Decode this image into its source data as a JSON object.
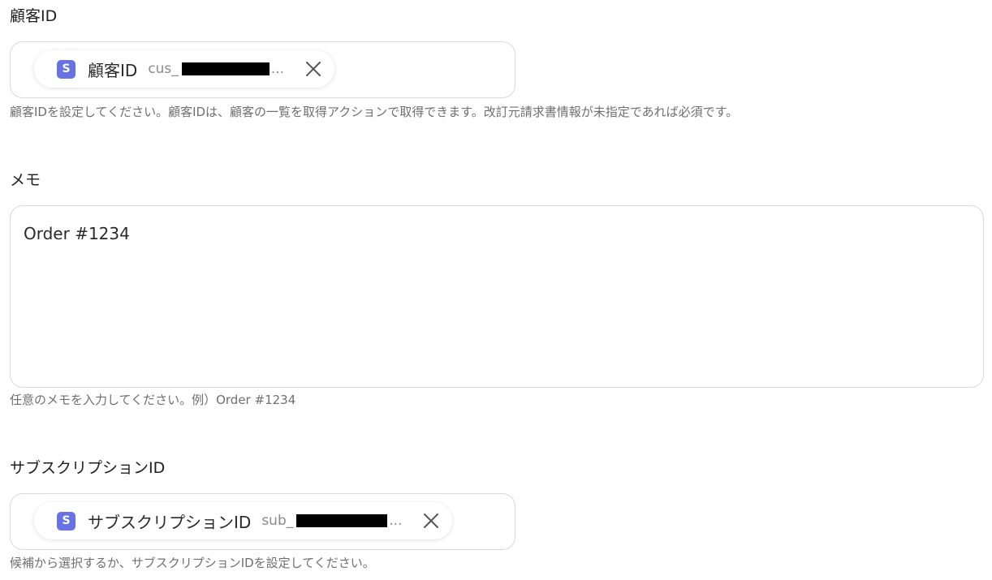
{
  "customer_id": {
    "label": "顧客ID",
    "chip": {
      "icon": "stripe-icon",
      "icon_letter": "S",
      "name": "顧客ID",
      "value_prefix": "cus_",
      "value_suffix": "..."
    },
    "help": "顧客IDを設定してください。顧客IDは、顧客の一覧を取得アクションで取得できます。改訂元請求書情報が未指定であれば必須です。"
  },
  "memo": {
    "label": "メモ",
    "value": "Order #1234",
    "help": "任意のメモを入力してください。例）Order #1234"
  },
  "subscription_id": {
    "label": "サブスクリプションID",
    "chip": {
      "icon": "stripe-icon",
      "icon_letter": "S",
      "name": "サブスクリプションID",
      "value_prefix": "sub_",
      "value_suffix": "..."
    },
    "help": "候補から選択するか、サブスクリプションIDを設定してください。"
  },
  "colors": {
    "stripe_brand": "#6772e5",
    "border": "#d9d9d9",
    "help_text": "#6f6f6f"
  }
}
